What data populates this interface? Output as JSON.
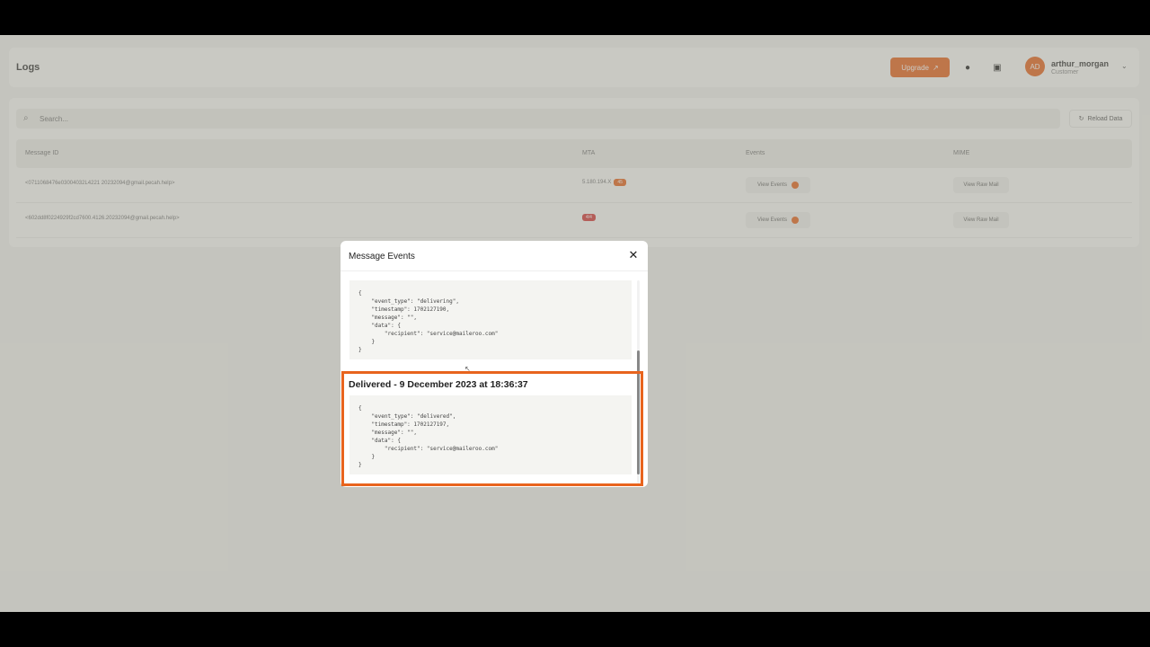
{
  "header": {
    "title": "Logs",
    "upgrade_label": "Upgrade",
    "upgrade_icon": "↗",
    "theme_icon": "●",
    "print_icon": "▣",
    "avatar_initials": "AD",
    "user_name": "arthur_morgan",
    "user_role": "Customer",
    "chevron": "⌄"
  },
  "search": {
    "icon": "⌕",
    "placeholder": "Search..."
  },
  "reload": {
    "icon": "↻",
    "label": "Reload Data"
  },
  "table": {
    "columns": [
      "Message ID",
      "MTA",
      "Events",
      "MIME"
    ],
    "rows": [
      {
        "message_id": "<0711068476e03004032L4221 20232094@gmail.pecah.help>",
        "mta": "5.180.194.X",
        "mta_badge": "45",
        "events_label": "View Events",
        "mime_label": "View Raw Mail"
      },
      {
        "message_id": "<602dd8f0224929f2cd7600.4126.20232094@gmail.pecah.help>",
        "mta": "",
        "mta_badge": "4/4",
        "events_label": "View Events",
        "mime_label": "View Raw Mail"
      }
    ]
  },
  "modal": {
    "title": "Message Events",
    "close_icon": "✕",
    "event1_json": "{\n    \"event_type\": \"delivering\",\n    \"timestamp\": 1702127190,\n    \"message\": \"\",\n    \"data\": {\n        \"recipient\": \"service@maileroo.com\"\n    }\n}",
    "event2_title": "Delivered - 9 December 2023 at 18:36:37",
    "event2_json": "{\n    \"event_type\": \"delivered\",\n    \"timestamp\": 1702127197,\n    \"message\": \"\",\n    \"data\": {\n        \"recipient\": \"service@maileroo.com\"\n    }\n}"
  },
  "colors": {
    "accent": "#e8641e",
    "highlight": "#e8641e",
    "danger": "#d63a3a"
  }
}
